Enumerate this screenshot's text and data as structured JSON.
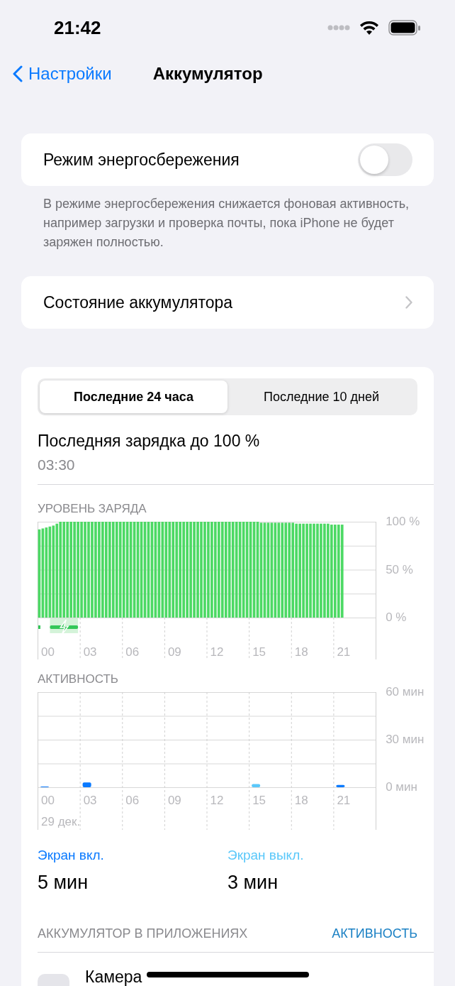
{
  "status_bar": {
    "time": "21:42"
  },
  "nav": {
    "back": "Настройки",
    "title": "Аккумулятор"
  },
  "low_power": {
    "label": "Режим энергосбережения",
    "on": false,
    "footer": "В режиме энергосбережения снижается фоновая активность, например загрузки и проверка почты, пока iPhone не будет заряжен полностью."
  },
  "health": {
    "label": "Состояние аккумулятора"
  },
  "tabs": [
    {
      "label": "Последние 24 часа",
      "selected": true
    },
    {
      "label": "Последние 10 дней",
      "selected": false
    }
  ],
  "last_charge": {
    "title": "Последняя зарядка до 100 %",
    "time": "03:30"
  },
  "level_chart": {
    "title": "УРОВЕНЬ ЗАРЯДА",
    "x_labels": [
      "00",
      "03",
      "06",
      "09",
      "12",
      "15",
      "18",
      "21"
    ],
    "chart_data": {
      "type": "bar",
      "ylim": [
        0,
        100
      ],
      "yticks": [
        {
          "value": 0,
          "label": "0 %"
        },
        {
          "value": 50,
          "label": "50 %"
        },
        {
          "value": 100,
          "label": "100 %"
        }
      ],
      "series": [
        {
          "color": "#4cd964",
          "values": [
            92,
            93,
            94,
            95,
            96,
            98,
            100,
            100,
            100,
            100,
            100,
            100,
            100,
            100,
            100,
            100,
            100,
            100,
            100,
            100,
            100,
            100,
            100,
            100,
            100,
            100,
            100,
            100,
            100,
            100,
            100,
            100,
            100,
            100,
            100,
            100,
            100,
            100,
            100,
            100,
            100,
            100,
            100,
            100,
            100,
            100,
            100,
            100,
            100,
            100,
            100,
            100,
            100,
            100,
            100,
            100,
            100,
            100,
            100,
            100,
            100,
            100,
            100,
            99,
            99,
            99,
            99,
            99,
            99,
            99,
            99,
            99,
            99,
            98,
            98,
            98,
            98,
            98,
            98,
            98,
            98,
            98,
            98,
            97,
            97,
            97,
            97
          ]
        }
      ]
    }
  },
  "activity_chart": {
    "title": "АКТИВНОСТЬ",
    "x_labels": [
      "00",
      "03",
      "06",
      "09",
      "12",
      "15",
      "18",
      "21"
    ],
    "date": "29 дек.",
    "chart_data": {
      "type": "bar",
      "ylim": [
        0,
        60
      ],
      "yticks": [
        {
          "value": 0,
          "label": "0 мин"
        },
        {
          "value": 30,
          "label": "30 мин"
        },
        {
          "value": 60,
          "label": "60 мин"
        }
      ],
      "series": [
        {
          "color": "#0a7aff",
          "values": [
            0.5,
            null,
            null,
            3,
            null,
            null,
            null,
            null,
            null,
            null,
            null,
            null,
            null,
            null,
            null,
            null,
            null,
            null,
            null,
            null,
            null,
            1.5,
            null,
            null
          ]
        },
        {
          "color": "#5ac8fa",
          "values": [
            null,
            null,
            null,
            null,
            null,
            null,
            null,
            null,
            null,
            null,
            null,
            null,
            null,
            null,
            null,
            2,
            null,
            null,
            null,
            null,
            null,
            null,
            null,
            null
          ]
        }
      ]
    }
  },
  "totals": [
    {
      "label": "Экран вкл.",
      "value": "5 мин",
      "color": "#0a7aff"
    },
    {
      "label": "Экран выкл.",
      "value": "3 мин",
      "color": "#5ac8fa"
    }
  ],
  "apps_header": {
    "title": "АККУМУЛЯТОР В ПРИЛОЖЕНИЯХ",
    "action": "АКТИВНОСТЬ"
  },
  "apps": [
    {
      "name": "Камера"
    }
  ]
}
